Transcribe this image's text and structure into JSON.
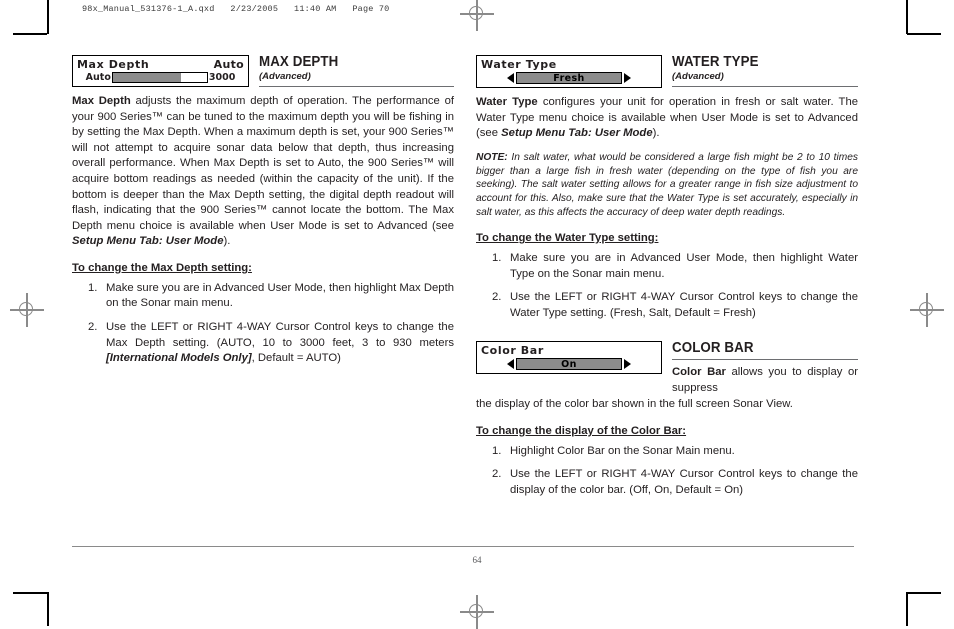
{
  "prepress": {
    "header_line": "98x_Manual_531376-1_A.qxd   2/23/2005   11:40 AM   Page 70"
  },
  "footer": {
    "page_number": "64"
  },
  "left_column": {
    "section": {
      "title": "MAX DEPTH",
      "subtitle": "(Advanced)",
      "widget": {
        "type": "slider",
        "label": "Max Depth",
        "value": "Auto",
        "min_label": "Auto",
        "max_label": "3000",
        "fill_percent": 72
      },
      "paragraph_1_lead": "Max Depth",
      "paragraph_1_rest": " adjusts the maximum depth of operation. The performance of your 900 Series™ can be tuned to the maximum depth you will be fishing in by setting the Max Depth. When a maximum depth is set, your 900 Series™ will not attempt to acquire sonar data below that depth, thus increasing overall performance. When Max Depth is set to Auto, the 900 Series™ will acquire bottom readings as needed (within the capacity of the unit). If the bottom is deeper than the Max Depth setting, the digital depth readout will flash, indicating that the 900 Series™ cannot locate the bottom. The Max Depth menu choice is available when User Mode is set to Advanced (see ",
      "paragraph_1_ref": "Setup Menu Tab: User Mode",
      "paragraph_1_tail": ").",
      "subhead": "To change the Max Depth setting:",
      "steps": [
        {
          "text": "Make sure you are in Advanced User Mode, then highlight Max Depth on the Sonar main menu."
        },
        {
          "text_pre": "Use the LEFT or RIGHT 4-WAY Cursor Control keys to change the Max Depth setting. (AUTO, 10 to 3000 feet, 3 to 930 meters ",
          "emphasis": "[International Models Only]",
          "text_post": ", Default = AUTO)"
        }
      ]
    }
  },
  "right_column": {
    "water_type": {
      "title": "WATER TYPE",
      "subtitle": "(Advanced)",
      "widget": {
        "type": "option",
        "label": "Water Type",
        "value": "Fresh",
        "left_arrow": "left-arrow-icon",
        "right_arrow": "right-arrow-icon"
      },
      "paragraph_lead": "Water Type",
      "paragraph_rest": " configures your unit for operation in fresh or salt water. The Water Type menu choice is available when User Mode is set to Advanced (see ",
      "paragraph_ref": "Setup Menu Tab: User Mode",
      "paragraph_tail": ").",
      "note_label": "NOTE:",
      "note_text": " In salt water, what would be considered a large fish might be 2 to 10 times bigger than a large fish in fresh water (depending on the type of fish you are seeking).  The salt water setting allows for a greater range in fish size adjustment to account for this. Also, make sure that the Water Type is set accurately, especially in salt water, as this affects the accuracy of deep water depth readings.",
      "subhead": "To change the Water Type setting:",
      "steps": [
        {
          "text": "Make sure you are in Advanced User Mode, then highlight Water Type on the Sonar main menu."
        },
        {
          "text": "Use the LEFT or RIGHT 4-WAY Cursor Control keys to change the Water Type setting. (Fresh, Salt, Default = Fresh)"
        }
      ]
    },
    "color_bar": {
      "title": "COLOR BAR",
      "widget": {
        "type": "option",
        "label": "Color Bar",
        "value": "On",
        "left_arrow": "left-arrow-icon",
        "right_arrow": "right-arrow-icon"
      },
      "paragraph_lead": "Color Bar",
      "paragraph_rest_line1": " allows you to display or suppress",
      "paragraph_rest_line2": "the display of the color bar shown in the full screen Sonar View.",
      "subhead": "To change the display of the Color Bar:",
      "steps": [
        {
          "text": "Highlight Color Bar on the Sonar Main menu."
        },
        {
          "text": "Use the LEFT or RIGHT 4-WAY Cursor Control keys to change the display of the color bar. (Off, On, Default = On)"
        }
      ]
    }
  }
}
